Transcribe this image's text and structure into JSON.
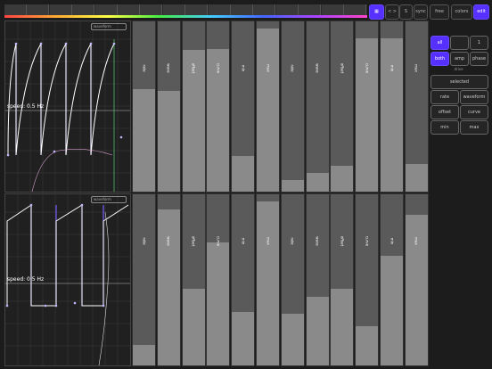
{
  "toolbar": {
    "buttons": [
      {
        "label": "",
        "icon": "grid-icon"
      },
      {
        "label": "< >"
      },
      {
        "label": "S"
      },
      {
        "label": "sync"
      },
      {
        "label": "free"
      },
      {
        "label": "colors"
      },
      {
        "label": "edit"
      }
    ]
  },
  "lfo": [
    {
      "speed": "speed: 0.5 Hz",
      "dropdown": "waveform"
    },
    {
      "speed": "speed: 0.5 Hz",
      "dropdown": "waveform"
    }
  ],
  "sliders": {
    "labels": [
      "rate",
      "wave",
      "offset",
      "curve",
      "min",
      "max",
      "rate",
      "wave",
      "offset",
      "curve",
      "min",
      "max"
    ],
    "row1_levels": [
      0.6,
      0.59,
      0.83,
      0.84,
      0.21,
      0.96,
      0.07,
      0.11,
      0.15,
      0.9,
      0.9,
      0.16
    ],
    "row2_levels": [
      0.12,
      0.91,
      0.45,
      0.72,
      0.31,
      0.96,
      0.3,
      0.4,
      0.45,
      0.23,
      0.64,
      0.88
    ]
  },
  "right": {
    "sync_buttons": [
      "all",
      "",
      "1"
    ],
    "mode_buttons": [
      "both",
      "amp",
      "phase"
    ],
    "mode_caption": "drive",
    "selected_label": "selected",
    "grid_buttons": [
      "rate",
      "waveform",
      "offset",
      "curve",
      "min",
      "max"
    ]
  },
  "colors": {
    "accent": "#5530ff"
  }
}
